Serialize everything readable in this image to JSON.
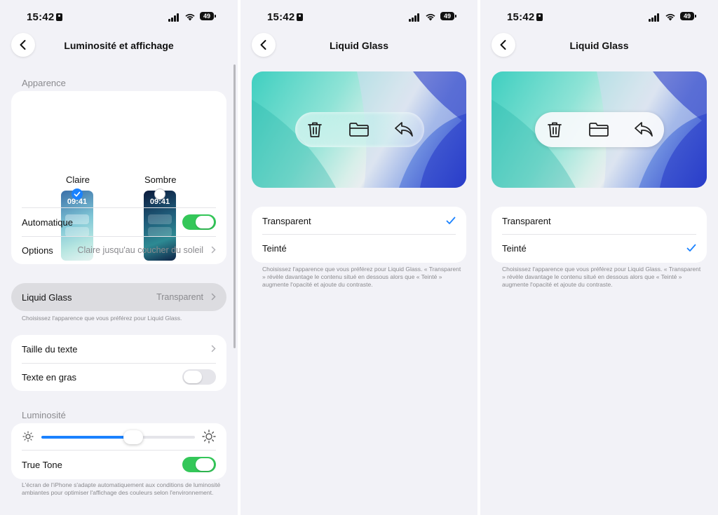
{
  "status": {
    "time": "15:42",
    "battery": "49"
  },
  "screen1": {
    "title": "Luminosité et affichage",
    "appearance_header": "Apparence",
    "appearance_options": [
      {
        "label": "Claire",
        "preview_time": "09:41",
        "selected": true
      },
      {
        "label": "Sombre",
        "preview_time": "09:41",
        "selected": false
      }
    ],
    "automatic_label": "Automatique",
    "automatic_on": true,
    "options_label": "Options",
    "options_value": "Claire jusqu'au coucher du soleil",
    "liquid_glass_label": "Liquid Glass",
    "liquid_glass_value": "Transparent",
    "liquid_glass_footer": "Choisissez l'apparence que vous préférez pour Liquid Glass.",
    "text_size_label": "Taille du texte",
    "bold_text_label": "Texte en gras",
    "bold_text_on": false,
    "brightness_header": "Luminosité",
    "brightness_level": 0.6,
    "true_tone_label": "True Tone",
    "true_tone_on": true,
    "true_tone_footer": "L'écran de l'iPhone s'adapte automatiquement aux conditions de luminosité ambiantes pour optimiser l'affichage des couleurs selon l'environnement."
  },
  "screen2": {
    "title": "Liquid Glass",
    "options": [
      "Transparent",
      "Teinté"
    ],
    "selected": "Transparent",
    "footer": "Choisissez l'apparence que vous préférez pour Liquid Glass. « Transparent » révèle davantage le contenu situé en dessous alors que « Teinté » augmente l'opacité et ajoute du contraste.",
    "toolbar_icons": [
      "trash-icon",
      "folder-icon",
      "reply-icon"
    ]
  },
  "screen3": {
    "title": "Liquid Glass",
    "options": [
      "Transparent",
      "Teinté"
    ],
    "selected": "Teinté",
    "footer": "Choisissez l'apparence que vous préférez pour Liquid Glass. « Transparent » révèle davantage le contenu situé en dessous alors que « Teinté » augmente l'opacité et ajoute du contraste.",
    "toolbar_icons": [
      "trash-icon",
      "folder-icon",
      "reply-icon"
    ]
  },
  "colors": {
    "accent": "#1a82ff",
    "toggle_on": "#34c759",
    "background": "#f2f2f7",
    "secondary_text": "#8a8a8e"
  }
}
